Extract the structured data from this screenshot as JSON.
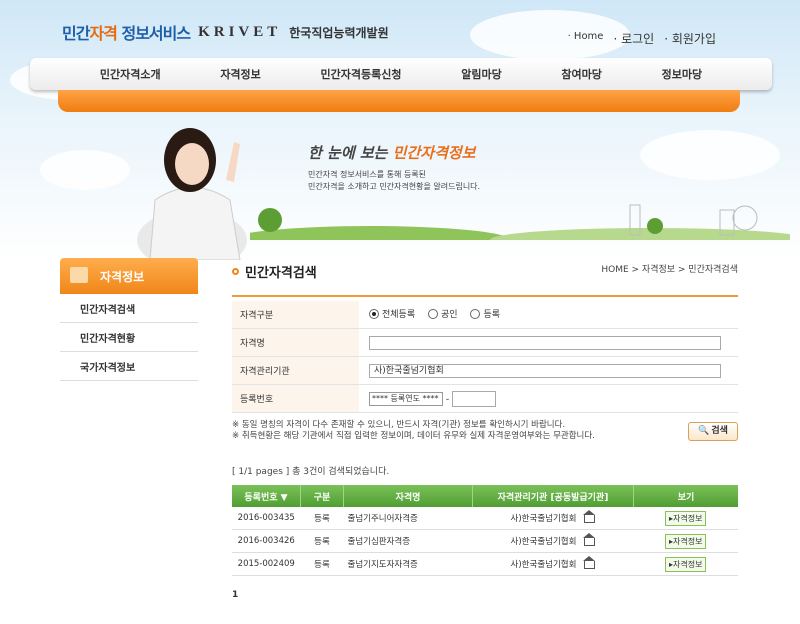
{
  "logo": {
    "service_prefix": "민간",
    "service_mid": "자격",
    "service_suffix": " 정보서비스",
    "partner": "KRIVET",
    "partner_korean": "한국직업능력개발원"
  },
  "top_links": {
    "home": "· Home",
    "login": "· 로그인",
    "signup": "· 회원가입"
  },
  "nav": [
    "민간자격소개",
    "자격정보",
    "민간자격등록신청",
    "알림마당",
    "참여마당",
    "정보마당"
  ],
  "banner": {
    "slogan_prefix": "한 눈에 보는 ",
    "slogan_highlight": "민간자격정보",
    "desc_line1": "민간자격 정보서비스를 통해 등록된",
    "desc_line2": "민간자격을 소개하고 민간자격현황을 알려드립니다."
  },
  "sidebar": {
    "title": "자격정보",
    "items": [
      "민간자격검색",
      "민간자격현황",
      "국가자격정보"
    ]
  },
  "page": {
    "title": "민간자격검색",
    "breadcrumb": "HOME > 자격정보 > 민간자격검색"
  },
  "form": {
    "type_label": "자격구분",
    "type_options": [
      "전체등록",
      "공인",
      "등록"
    ],
    "type_selected": "전체등록",
    "name_label": "자격명",
    "name_value": "",
    "org_label": "자격관리기관",
    "org_value": "사)한국줄넘기협회",
    "regno_label": "등록번호",
    "regno_year": "**** 등록연도 ****",
    "regno_dash": "-"
  },
  "notice": {
    "line1": "※ 동일 명칭의 자격이 다수 존재할 수 있으니, 반드시 자격(기관) 정보를 확인하시기 바랍니다.",
    "line2": "※ 취득현황은 해당 기관에서 직접 입력한 정보이며, 데이터 유무와 실제 자격운영여부와는 무관합니다.",
    "search_button": "검색"
  },
  "results": {
    "summary": "[ 1/1 pages ] 총 3건이 검색되었습니다.",
    "columns": [
      "등록번호 ▼",
      "구분",
      "자격명",
      "자격관리기관 [공동발급기관]",
      "보기"
    ],
    "rows": [
      {
        "no": "2016-003435",
        "type": "등록",
        "name": "줄넘기주니어자격증",
        "org": "사)한국줄넘기협회",
        "view": "▸자격정보"
      },
      {
        "no": "2016-003426",
        "type": "등록",
        "name": "줄넘기심판자격증",
        "org": "사)한국줄넘기협회",
        "view": "▸자격정보"
      },
      {
        "no": "2015-002409",
        "type": "등록",
        "name": "줄넘기지도자자격증",
        "org": "사)한국줄넘기협회",
        "view": "▸자격정보"
      }
    ],
    "page": "1"
  },
  "colors": {
    "accent_orange": "#f08619",
    "accent_green": "#5aa83c",
    "logo_blue": "#1f5fa8"
  }
}
